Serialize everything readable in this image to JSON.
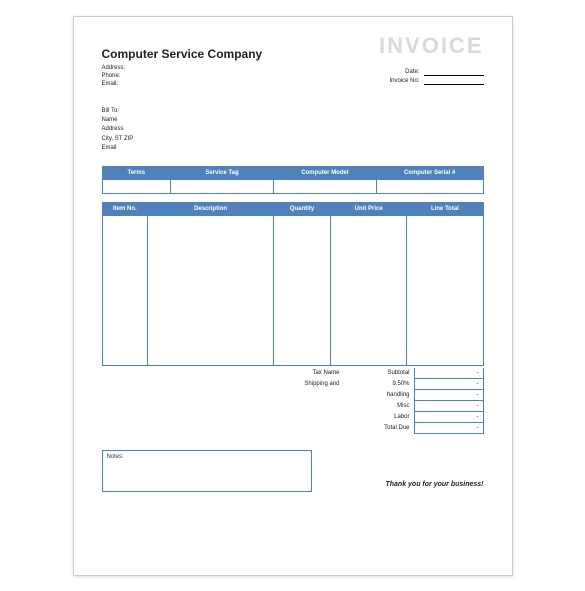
{
  "title": "INVOICE",
  "company_name": "Computer Service Company",
  "from_labels": {
    "address": "Address:",
    "phone": "Phone:",
    "email": "Email:"
  },
  "meta_labels": {
    "date": "Date:",
    "invoice_no": "Invoice No:"
  },
  "bill_to": {
    "heading": "Bill To:",
    "name": "Name",
    "address": "Address",
    "city": "City, ST ZIP",
    "email": "Email"
  },
  "service_headers": {
    "terms": "Terms",
    "tag": "Service Tag",
    "model": "Computer Model",
    "serial": "Computer Serial #"
  },
  "item_headers": {
    "no": "Item No.",
    "desc": "Description",
    "qty": "Quantity",
    "price": "Unit Price",
    "total": "Line Total"
  },
  "summary": {
    "tax_name": "Tax Name",
    "shipping": "Shipping and",
    "subtotal": "Subtotal",
    "tax_rate": "9.50%",
    "handling": "handling",
    "misc": "Misc",
    "labor": "Labor",
    "total_due": "Total Due",
    "dash": "-"
  },
  "notes_label": "Notes:",
  "thanks": "Thank you for your business!"
}
